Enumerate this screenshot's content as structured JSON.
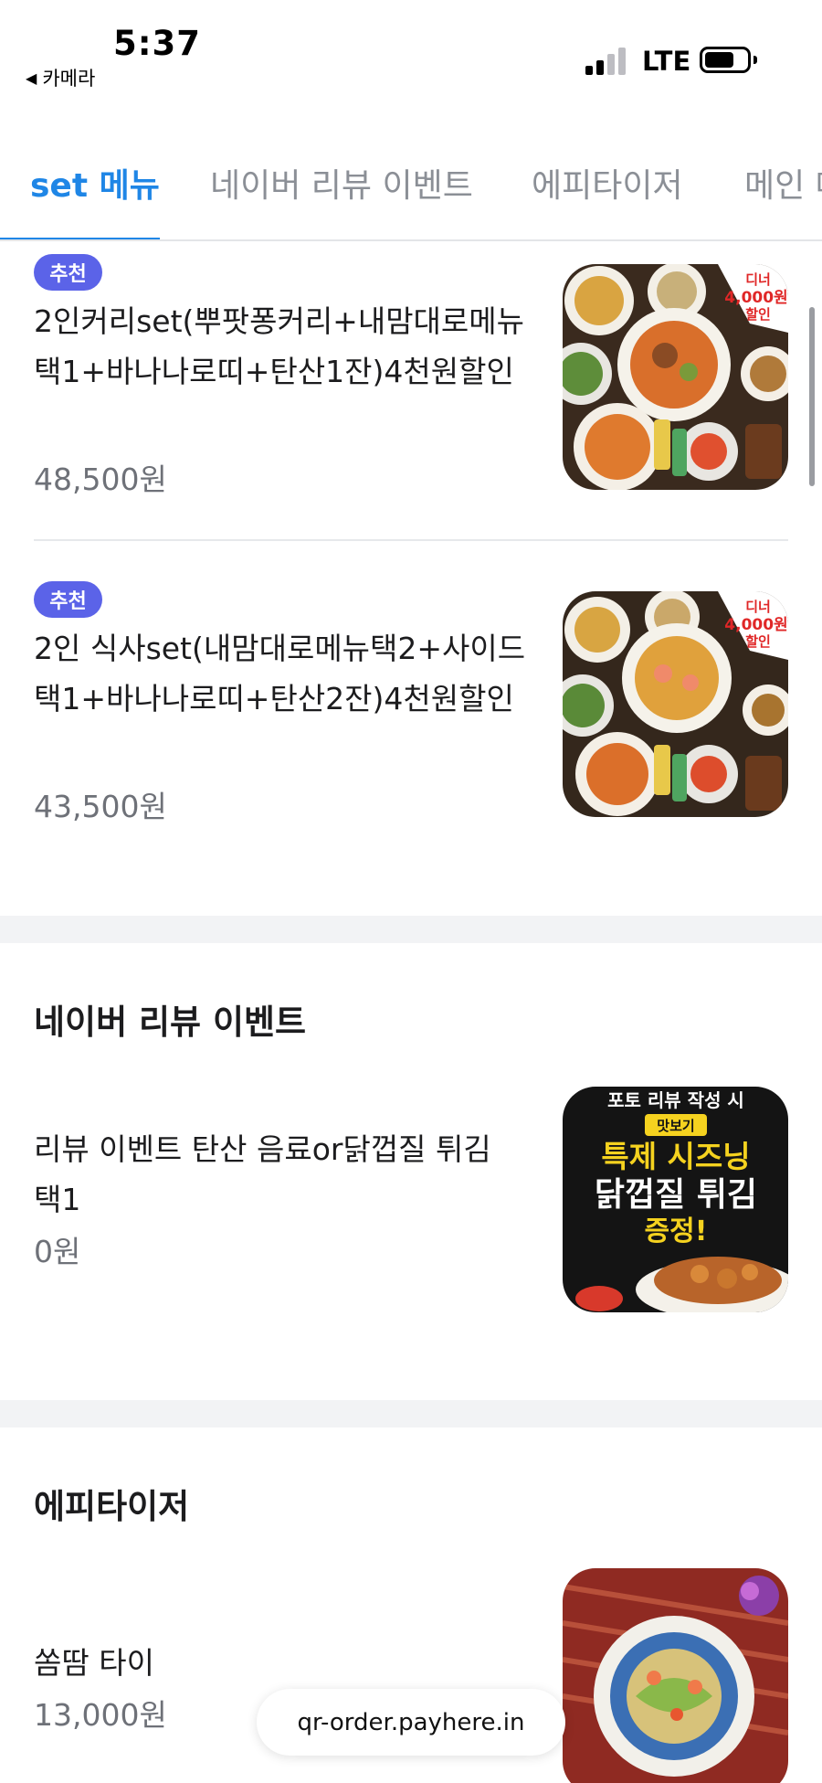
{
  "status_bar": {
    "time": "5:37",
    "back_label": "카메라",
    "network": "LTE"
  },
  "tabs": [
    {
      "label": "set 메뉴",
      "active": true
    },
    {
      "label": "네이버 리뷰 이벤트",
      "active": false
    },
    {
      "label": "에피타이저",
      "active": false
    },
    {
      "label": "메인 메뉴",
      "active": false
    }
  ],
  "set_menu": {
    "items": [
      {
        "badge": "추천",
        "name": "2인커리set(뿌팟퐁커리+내맘대로메뉴택1+바나나로띠+탄산1잔)4천원할인",
        "price": "48,500원",
        "image_badge": [
          "디너",
          "4,000원",
          "할인"
        ]
      },
      {
        "badge": "추천",
        "name": "2인 식사set(내맘대로메뉴택2+사이드택1+바나나로띠+탄산2잔)4천원할인",
        "price": "43,500원",
        "image_badge": [
          "디너",
          "4,000원",
          "할인"
        ]
      }
    ]
  },
  "review_section": {
    "title": "네이버 리뷰 이벤트",
    "item": {
      "name": "리뷰 이벤트 탄산 음료or닭껍질 튀김 택1",
      "price": "0원",
      "image_text": [
        "포토 리뷰 작성 시",
        "맛보기",
        "특제 시즈닝",
        "닭껍질 튀김",
        "증정!"
      ]
    }
  },
  "appetizer_section": {
    "title": "에피타이저",
    "item": {
      "name": "쏨땀 타이",
      "price": "13,000원"
    }
  },
  "url_bar": {
    "url": "qr-order.payhere.in"
  },
  "colors": {
    "accent": "#1f86e6",
    "badge": "#5b63e8",
    "price_text": "#6e7178",
    "section_gap": "#f2f3f5"
  }
}
